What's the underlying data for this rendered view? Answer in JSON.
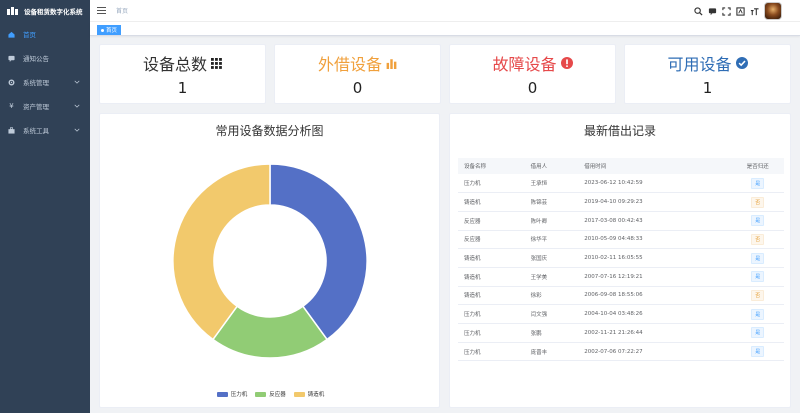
{
  "app": {
    "title": "设备租赁数字化系统"
  },
  "sidebar": {
    "items": [
      {
        "label": "首页",
        "active": true,
        "has_arrow": false,
        "icon": "home-icon"
      },
      {
        "label": "通知公告",
        "active": false,
        "has_arrow": false,
        "icon": "message-icon"
      },
      {
        "label": "系统管理",
        "active": false,
        "has_arrow": true,
        "icon": "gear-icon"
      },
      {
        "label": "资产管理",
        "active": false,
        "has_arrow": true,
        "icon": "yen-icon"
      },
      {
        "label": "系统工具",
        "active": false,
        "has_arrow": true,
        "icon": "toolbox-icon"
      }
    ]
  },
  "header": {
    "breadcrumb": "首页"
  },
  "tags": [
    {
      "label": "首页"
    }
  ],
  "stats": [
    {
      "title": "设备总数",
      "value": "1",
      "color": "#333333",
      "icon": "grid-icon"
    },
    {
      "title": "外借设备",
      "value": "0",
      "color": "#f0a03c",
      "icon": "bar-chart-icon"
    },
    {
      "title": "故障设备",
      "value": "0",
      "color": "#e6494a",
      "icon": "alert-icon"
    },
    {
      "title": "可用设备",
      "value": "1",
      "color": "#2f6db5",
      "icon": "check-circle-icon"
    }
  ],
  "chart_panel": {
    "title": "常用设备数据分析图"
  },
  "table_panel": {
    "title": "最新借出记录"
  },
  "table": {
    "headers": [
      "设备名称",
      "借用人",
      "借用时间",
      "是否归还"
    ],
    "rows": [
      {
        "name": "压力机",
        "borrower": "王承恒",
        "time": "2023-06-12 10:42:59",
        "returned": "是"
      },
      {
        "name": "铸造机",
        "borrower": "陈锦芸",
        "time": "2019-04-10 09:29:23",
        "returned": "否"
      },
      {
        "name": "反应器",
        "borrower": "陈叶卿",
        "time": "2017-03-08 00:42:43",
        "returned": "是"
      },
      {
        "name": "反应器",
        "borrower": "徐华平",
        "time": "2010-05-09 04:48:33",
        "returned": "否"
      },
      {
        "name": "铸造机",
        "borrower": "张国庆",
        "time": "2010-02-11 16:05:55",
        "returned": "是"
      },
      {
        "name": "铸造机",
        "borrower": "王学美",
        "time": "2007-07-16 12:19:21",
        "returned": "是"
      },
      {
        "name": "铸造机",
        "borrower": "徐彩",
        "time": "2006-09-08 18:55:06",
        "returned": "否"
      },
      {
        "name": "压力机",
        "borrower": "闫文强",
        "time": "2004-10-04 03:48:26",
        "returned": "是"
      },
      {
        "name": "压力机",
        "borrower": "张鹏",
        "time": "2002-11-21 21:26:44",
        "returned": "是"
      },
      {
        "name": "压力机",
        "borrower": "庞晋丰",
        "time": "2002-07-06 07:22:27",
        "returned": "是"
      }
    ]
  },
  "colors": {
    "badge_yes_bg": "#ecf5ff",
    "badge_yes_fg": "#409eff",
    "badge_no_bg": "#fdf6ec",
    "badge_no_fg": "#e6a23c"
  },
  "chart_data": {
    "type": "pie",
    "style": "donut",
    "categories": [
      "压力机",
      "反应器",
      "铸造机"
    ],
    "values": [
      40,
      20,
      40
    ],
    "colors": [
      "#5470c6",
      "#91cc75",
      "#f2c96c"
    ],
    "legend_placement": "bottom"
  }
}
